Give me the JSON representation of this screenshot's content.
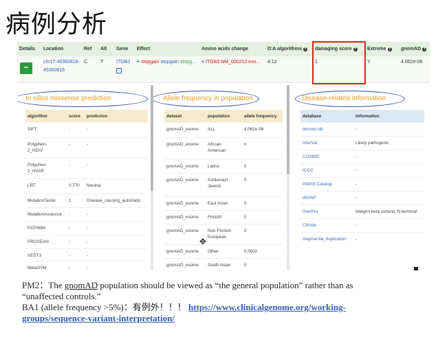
{
  "title": "病例分析",
  "main_table": {
    "headers": {
      "details": "Details",
      "location": "Location",
      "ref": "Ref",
      "alt": "Alt",
      "gene": "Gene",
      "effect": "Effect",
      "amino": "Amino acids change",
      "da": "D:A algorithms",
      "damaging": "damaging score",
      "extreme": "Extreme",
      "gnomad": "gnomAD"
    },
    "row": {
      "expand": "−",
      "location_line1": "chr17:45360816-",
      "location_line2": "45360816",
      "ref": "C",
      "alt": "T",
      "gene": "ITGB3",
      "effect_plus": "+",
      "effect_text1": "stopgain",
      "effect_text2": "stopgain",
      "effect_text3": "stopg...",
      "amino_plus": "+",
      "amino_text": "ITGB3:NM_000212:exo...",
      "da": "4:12",
      "damaging": "1",
      "extreme": "Y",
      "gnomad": "4.062e-06"
    }
  },
  "insilico": {
    "label": "In silico missense prediction",
    "headers": [
      "algorithm",
      "score",
      "prediction"
    ],
    "rows": [
      [
        "SIFT",
        "-",
        "-"
      ],
      [
        "Polyphen-\n2_HDIV",
        "-",
        "-"
      ],
      [
        "Polyphen-\n2_HVAR",
        "-",
        "-"
      ],
      [
        "LRT",
        "0.770",
        "Neutral"
      ],
      [
        "MutationTaster",
        "1",
        "Disease_causing_automatic"
      ],
      [
        "MutationAssessor",
        "-",
        "-"
      ],
      [
        "FATHMM",
        "-",
        "-"
      ],
      [
        "PROVEAN",
        "-",
        "-"
      ],
      [
        "VEST3",
        "-",
        "-"
      ],
      [
        "MetaSVM",
        "-",
        "-"
      ]
    ]
  },
  "allele": {
    "label": "Allele frequency in population",
    "headers": [
      "dataset",
      "population",
      "allele frequency"
    ],
    "rows": [
      [
        "gnomAD_exome",
        "ALL",
        "4.062e-06"
      ],
      [
        "gnomAD_exome",
        "African\nAmerican",
        "0"
      ],
      [
        "gnomAD_exome",
        "Latino",
        "0"
      ],
      [
        "gnomAD_exome",
        "Ashkenazi\nJewish",
        "0"
      ],
      [
        "gnomAD_exome",
        "East Asian",
        "0"
      ],
      [
        "gnomAD_exome",
        "Finnish",
        "0"
      ],
      [
        "gnomAD_exome",
        "Non-Finnish\nEuropean",
        "0"
      ],
      [
        "gnomAD_exome",
        "Other",
        "0.0002"
      ],
      [
        "gnomAD_exome",
        "South Asian",
        "0"
      ]
    ]
  },
  "disease": {
    "label": "Disease-related information",
    "headers": [
      "database",
      "information"
    ],
    "rows": [
      [
        "denovo-db",
        "-"
      ],
      [
        "InterVar",
        "Likely pathogenic"
      ],
      [
        "COSMIC",
        "-"
      ],
      [
        "ICGC",
        "-"
      ],
      [
        "GWAS Catalog",
        "-"
      ],
      [
        "dbSNP",
        "-"
      ],
      [
        "InterPro",
        "Integrin beta subunit, N-terminal"
      ],
      [
        "ClinVar",
        "-"
      ],
      [
        "Segmental_duplication",
        "-"
      ]
    ]
  },
  "footer": {
    "l1_a": "PM2：The ",
    "l1_b": "gnomAD",
    "l1_c": " population should be viewed as “the general population” rather than as",
    "l2": "“unaffected controls.”",
    "l3_a": "BA1 (allele frequency >5%)：有例外！！！  ",
    "link1": "https://www.clinicalgenome.org/working-",
    "link2": "groups/sequence-variant-interpretation/"
  },
  "colors": {
    "accent_green": "#2a9a3c",
    "highlight_red": "#d9251a",
    "oval_blue": "#2e4aa0",
    "label_orange": "#e89a17"
  }
}
